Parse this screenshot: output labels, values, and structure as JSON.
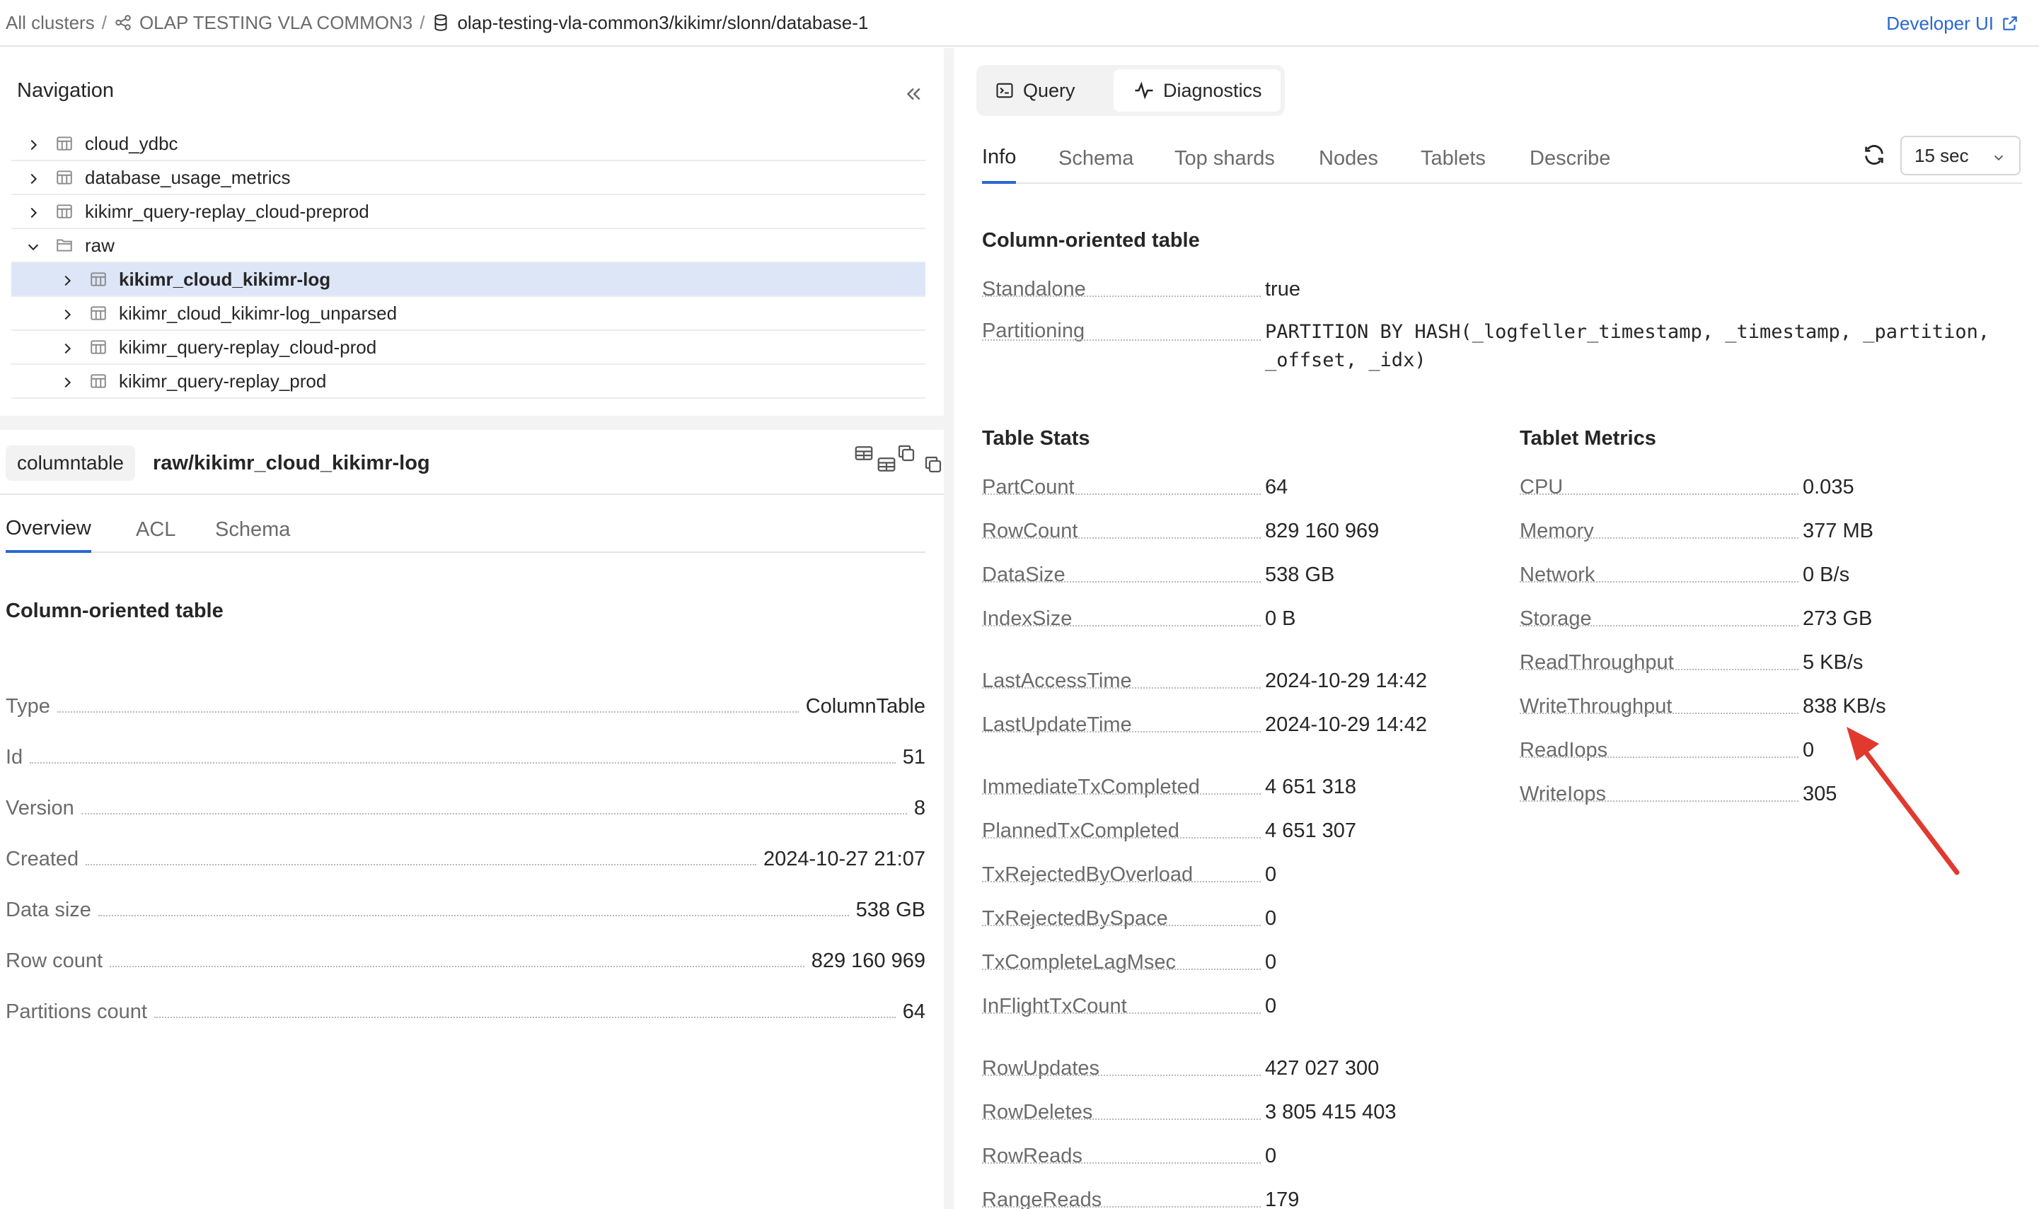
{
  "breadcrumb": {
    "root": "All clusters",
    "cluster": "OLAP TESTING VLA COMMON3",
    "database": "olap-testing-vla-common3/kikimr/slonn/database-1",
    "separator": "/"
  },
  "developer_ui": "Developer UI",
  "navigation": {
    "title": "Navigation",
    "items": [
      {
        "label": "cloud_ydbc",
        "type": "table",
        "expanded": false
      },
      {
        "label": "database_usage_metrics",
        "type": "table",
        "expanded": false
      },
      {
        "label": "kikimr_query-replay_cloud-preprod",
        "type": "table",
        "expanded": false
      },
      {
        "label": "raw",
        "type": "folder",
        "expanded": true
      },
      {
        "label": "kikimr_cloud_kikimr-log",
        "type": "table",
        "expanded": false,
        "selected": true
      },
      {
        "label": "kikimr_cloud_kikimr-log_unparsed",
        "type": "table",
        "expanded": false
      },
      {
        "label": "kikimr_query-replay_cloud-prod",
        "type": "table",
        "expanded": false
      },
      {
        "label": "kikimr_query-replay_prod",
        "type": "table",
        "expanded": false
      }
    ]
  },
  "object": {
    "type_badge": "columntable",
    "path": "raw/kikimr_cloud_kikimr-log",
    "tabs": [
      "Overview",
      "ACL",
      "Schema"
    ],
    "overview_title": "Column-oriented table",
    "overview": [
      {
        "key": "Type",
        "value": "ColumnTable"
      },
      {
        "key": "Id",
        "value": "51"
      },
      {
        "key": "Version",
        "value": "8"
      },
      {
        "key": "Created",
        "value": "2024-10-27 21:07"
      },
      {
        "key": "Data size",
        "value": "538 GB"
      },
      {
        "key": "Row count",
        "value": "829 160 969"
      },
      {
        "key": "Partitions count",
        "value": "64"
      }
    ]
  },
  "mode": {
    "query": "Query",
    "diagnostics": "Diagnostics"
  },
  "diag_tabs": [
    "Info",
    "Schema",
    "Top shards",
    "Nodes",
    "Tablets",
    "Describe"
  ],
  "refresh_interval": "15 sec",
  "info": {
    "title": "Column-oriented table",
    "standalone": {
      "key": "Standalone",
      "value": "true"
    },
    "partitioning": {
      "key": "Partitioning",
      "line1": "PARTITION BY HASH(_logfeller_timestamp, _timestamp, _partition,",
      "line2": "_offset, _idx)"
    },
    "table_stats_title": "Table Stats",
    "table_stats_group1": [
      {
        "key": "PartCount",
        "value": "64"
      },
      {
        "key": "RowCount",
        "value": "829 160 969"
      },
      {
        "key": "DataSize",
        "value": "538 GB"
      },
      {
        "key": "IndexSize",
        "value": "0 B"
      }
    ],
    "table_stats_group2": [
      {
        "key": "LastAccessTime",
        "value": "2024-10-29 14:42"
      },
      {
        "key": "LastUpdateTime",
        "value": "2024-10-29 14:42"
      }
    ],
    "table_stats_group3": [
      {
        "key": "ImmediateTxCompleted",
        "value": "4 651 318"
      },
      {
        "key": "PlannedTxCompleted",
        "value": "4 651 307"
      },
      {
        "key": "TxRejectedByOverload",
        "value": "0"
      },
      {
        "key": "TxRejectedBySpace",
        "value": "0"
      },
      {
        "key": "TxCompleteLagMsec",
        "value": "0"
      },
      {
        "key": "InFlightTxCount",
        "value": "0"
      }
    ],
    "table_stats_group4": [
      {
        "key": "RowUpdates",
        "value": "427 027 300"
      },
      {
        "key": "RowDeletes",
        "value": "3 805 415 403"
      },
      {
        "key": "RowReads",
        "value": "0"
      },
      {
        "key": "RangeReads",
        "value": "179"
      }
    ],
    "tablet_metrics_title": "Tablet Metrics",
    "tablet_metrics": [
      {
        "key": "CPU",
        "value": "0.035"
      },
      {
        "key": "Memory",
        "value": "377 MB"
      },
      {
        "key": "Network",
        "value": "0 B/s"
      },
      {
        "key": "Storage",
        "value": "273 GB"
      },
      {
        "key": "ReadThroughput",
        "value": "5 KB/s"
      },
      {
        "key": "WriteThroughput",
        "value": "838 KB/s"
      },
      {
        "key": "ReadIops",
        "value": "0"
      },
      {
        "key": "WriteIops",
        "value": "305"
      }
    ]
  },
  "colors": {
    "accent": "#2a67d1",
    "selected_row": "#dde6f7",
    "annotation_arrow": "#e03a2f"
  }
}
